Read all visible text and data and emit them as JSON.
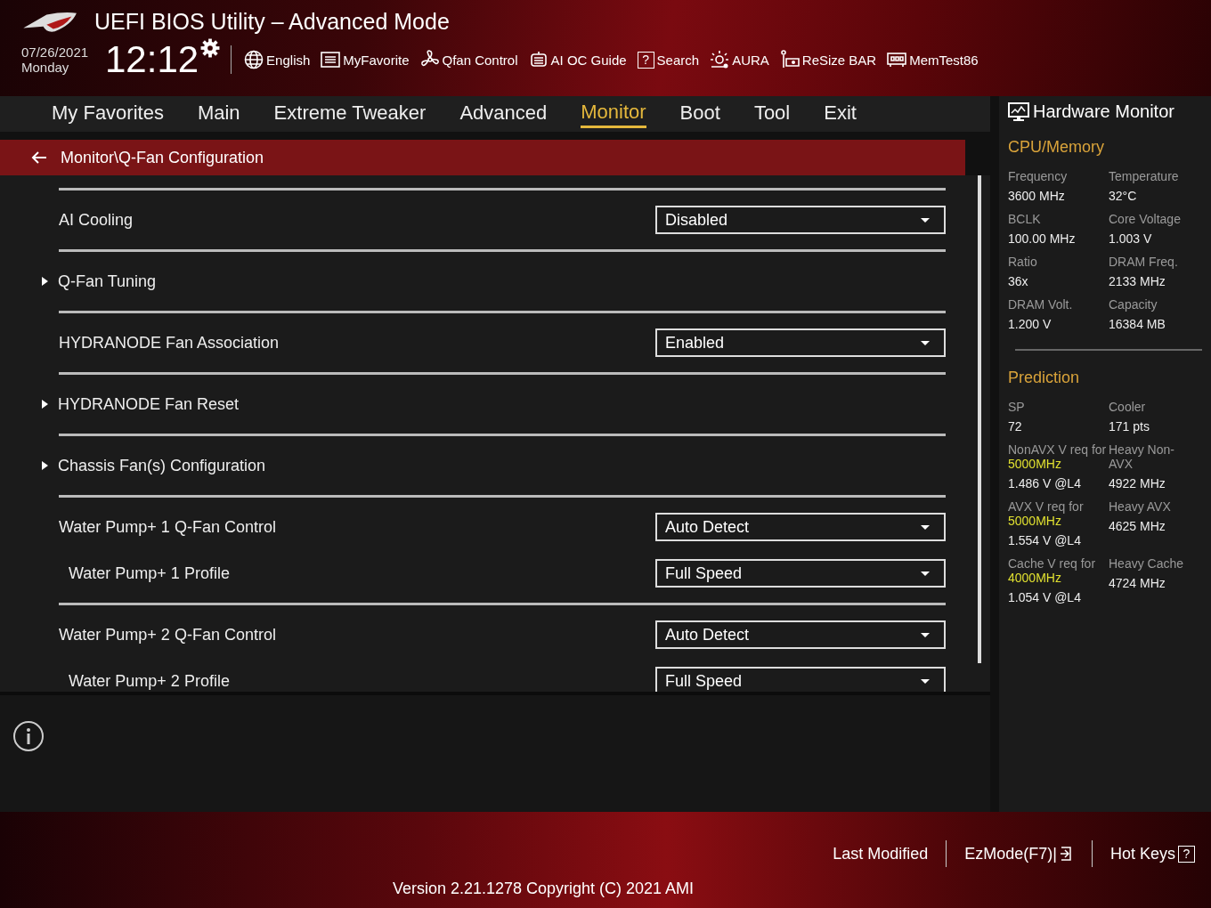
{
  "header": {
    "title": "UEFI BIOS Utility – Advanced Mode",
    "date": "07/26/2021",
    "day": "Monday",
    "time": "12:12",
    "tools": [
      {
        "kind": "globe",
        "label": "English"
      },
      {
        "kind": "list",
        "label": "MyFavorite"
      },
      {
        "kind": "fan",
        "label": "Qfan Control"
      },
      {
        "kind": "chip",
        "label": "AI OC Guide"
      },
      {
        "kind": "help",
        "icon_text": "?",
        "label": "Search"
      },
      {
        "kind": "light",
        "label": "AURA"
      },
      {
        "kind": "card",
        "label": "ReSize BAR"
      },
      {
        "kind": "memory",
        "label": "MemTest86"
      }
    ]
  },
  "tabs": [
    {
      "label": "My Favorites",
      "selected": false
    },
    {
      "label": "Main",
      "selected": false
    },
    {
      "label": "Extreme Tweaker",
      "selected": false
    },
    {
      "label": "Advanced",
      "selected": false
    },
    {
      "label": "Monitor",
      "selected": true
    },
    {
      "label": "Boot",
      "selected": false
    },
    {
      "label": "Tool",
      "selected": false
    },
    {
      "label": "Exit",
      "selected": false
    }
  ],
  "breadcrumb": "Monitor\\Q-Fan Configuration",
  "items": [
    {
      "kind": "dropdown",
      "label": "AI Cooling",
      "value": "Disabled"
    },
    {
      "kind": "submenu",
      "label": "Q-Fan Tuning"
    },
    {
      "kind": "dropdown",
      "label": "HYDRANODE Fan Association",
      "value": "Enabled"
    },
    {
      "kind": "submenu",
      "label": "HYDRANODE Fan Reset"
    },
    {
      "kind": "submenu",
      "label": "Chassis Fan(s) Configuration"
    },
    {
      "kind": "dropdown",
      "label": "Water Pump+ 1 Q-Fan Control",
      "value": "Auto Detect",
      "children": [
        {
          "kind": "dropdown",
          "label": "Water Pump+ 1 Profile",
          "value": "Full Speed"
        }
      ]
    },
    {
      "kind": "dropdown",
      "label": "Water Pump+ 2 Q-Fan Control",
      "value": "Auto Detect",
      "children": [
        {
          "kind": "dropdown",
          "label": "Water Pump+ 2 Profile",
          "value": "Full Speed"
        }
      ]
    }
  ],
  "hardware_monitor": {
    "title": "Hardware Monitor",
    "sections": [
      {
        "title": "CPU/Memory",
        "cells": [
          {
            "label": "Frequency",
            "value": "3600 MHz"
          },
          {
            "label": "Temperature",
            "value": "32°C"
          },
          {
            "label": "BCLK",
            "value": "100.00 MHz"
          },
          {
            "label": "Core Voltage",
            "value": "1.003 V"
          },
          {
            "label": "Ratio",
            "value": "36x"
          },
          {
            "label": "DRAM Freq.",
            "value": "2133 MHz"
          },
          {
            "label": "DRAM Volt.",
            "value": "1.200 V"
          },
          {
            "label": "Capacity",
            "value": "16384 MB"
          }
        ]
      },
      {
        "title": "Prediction",
        "cells": [
          {
            "label": "SP",
            "value": "72"
          },
          {
            "label": "Cooler",
            "value": "171 pts"
          },
          {
            "label": "NonAVX V req for",
            "highlight": "5000MHz",
            "value": "1.486 V @L4"
          },
          {
            "label": "Heavy Non-AVX",
            "value": "4922 MHz"
          },
          {
            "label": "AVX V req for",
            "highlight": "5000MHz",
            "value": "1.554 V @L4"
          },
          {
            "label": "Heavy AVX",
            "value": "4625 MHz"
          },
          {
            "label": "Cache V req for",
            "highlight": "4000MHz",
            "value": "1.054 V @L4"
          },
          {
            "label": "Heavy Cache",
            "value": "4724 MHz"
          }
        ]
      }
    ]
  },
  "footer": {
    "actions": [
      {
        "label": "Last Modified"
      },
      {
        "label": "EzMode(F7)|",
        "kind": "exit"
      },
      {
        "label": "Hot Keys",
        "kind": "help",
        "icon_text": "?"
      }
    ],
    "version": "Version 2.21.1278 Copyright (C) 2021 AMI"
  }
}
